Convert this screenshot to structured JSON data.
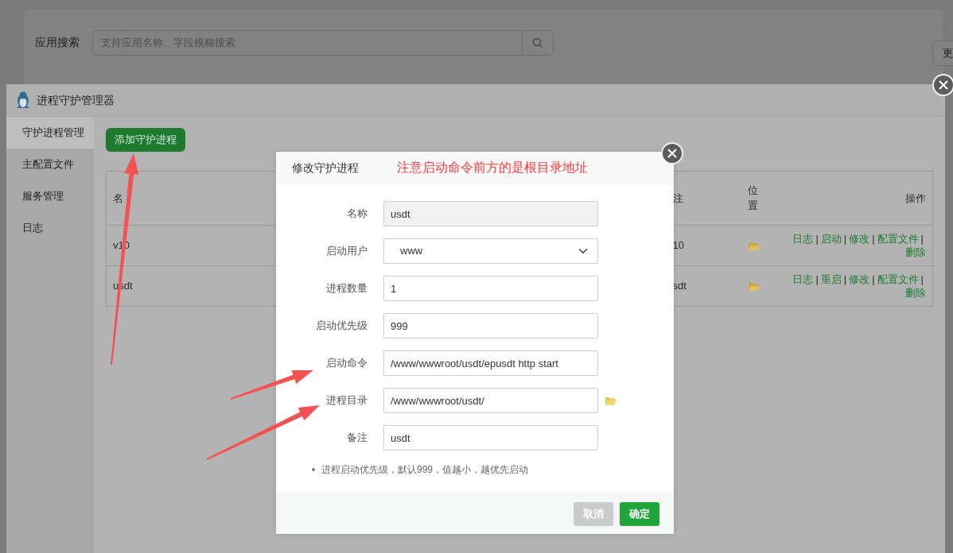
{
  "search": {
    "label": "应用搜索",
    "placeholder": "支持应用名称、字段模糊搜索"
  },
  "edge_button": "更",
  "window": {
    "title": "进程守护管理器"
  },
  "sidebar": {
    "items": [
      {
        "label": "守护进程管理",
        "selected": true
      },
      {
        "label": "主配置文件",
        "selected": false
      },
      {
        "label": "服务管理",
        "selected": false
      },
      {
        "label": "日志",
        "selected": false
      }
    ]
  },
  "add_button": "添加守护进程",
  "table": {
    "name_header": "名",
    "remark_header": "注",
    "location_header": "位置",
    "actions_header": "操作",
    "separator": "|",
    "rows": [
      {
        "name": "v10",
        "remark": "10",
        "actions": [
          "日志",
          "启动",
          "修改",
          "配置文件",
          "删除"
        ]
      },
      {
        "name": "usdt",
        "remark": "sdt",
        "actions": [
          "日志",
          "重启",
          "修改",
          "配置文件",
          "删除"
        ]
      }
    ]
  },
  "dialog": {
    "title": "修改守护进程",
    "annotation": "注意启动命令前方的是根目录地址",
    "fields": [
      {
        "label": "名称",
        "kind": "readonly",
        "value": "usdt"
      },
      {
        "label": "启动用户",
        "kind": "select",
        "value": "www"
      },
      {
        "label": "进程数量",
        "kind": "text",
        "value": "1"
      },
      {
        "label": "启动优先级",
        "kind": "text",
        "value": "999"
      },
      {
        "label": "启动命令",
        "kind": "text",
        "value": "/www/wwwroot/usdt/epusdt http start"
      },
      {
        "label": "进程目录",
        "kind": "path",
        "value": "/www/wwwroot/usdt/"
      },
      {
        "label": "备注",
        "kind": "text",
        "value": "usdt"
      }
    ],
    "note": "进程启动优先级，默认999，值越小，越优先启动",
    "buttons": [
      {
        "label": "取消",
        "kind": "cancel"
      },
      {
        "label": "确定",
        "kind": "confirm"
      }
    ]
  }
}
